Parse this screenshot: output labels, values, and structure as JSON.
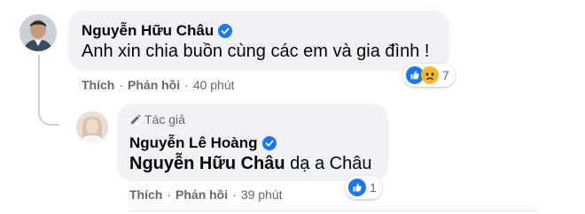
{
  "comments": [
    {
      "author": "Nguyễn Hữu Châu",
      "text": "Anh xin chia buồn cùng các em và gia đình !",
      "actions": {
        "like": "Thích",
        "reply": "Phản hồi",
        "time": "40 phút"
      },
      "reactions": {
        "icons": [
          "like-icon",
          "sad-icon"
        ],
        "count": "7"
      }
    },
    {
      "author_tag": "Tác giả",
      "author": "Nguyễn Lê Hoàng",
      "mention": "Nguyễn Hữu Châu",
      "text": " dạ a Châu",
      "actions": {
        "like": "Thích",
        "reply": "Phản hồi",
        "time": "39 phút"
      },
      "reactions": {
        "icons": [
          "like-icon"
        ],
        "count": "1"
      }
    }
  ],
  "separator": "·",
  "colors": {
    "bubble": "#f0f2f5",
    "verified": "#1877f2",
    "meta": "#65676b",
    "like": "#1877f2",
    "sad": "#f7b928"
  }
}
